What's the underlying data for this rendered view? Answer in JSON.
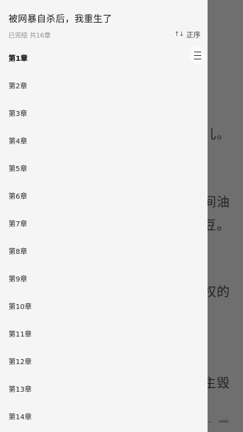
{
  "reader": {
    "lines": [
      "儿。",
      "间油",
      "豆。",
      "权的",
      "主毁"
    ]
  },
  "drawer": {
    "title": "被网暴自杀后，我重生了",
    "meta": "已完结 共16章",
    "sort_icon": "↑↓",
    "sort_label": "正序",
    "menu_icon": "hamburger-icon",
    "current_chapter_index": 0,
    "chapters": [
      "第1章",
      "第2章",
      "第3章",
      "第4章",
      "第5章",
      "第6章",
      "第7章",
      "第8章",
      "第9章",
      "第10章",
      "第11章",
      "第12章",
      "第13章",
      "第14章"
    ]
  },
  "colors": {
    "overlay": "#6f6f6f",
    "drawer_bg": "#f5f5f5",
    "text_primary": "#1a1a1a",
    "text_secondary": "#8b8b8b"
  }
}
